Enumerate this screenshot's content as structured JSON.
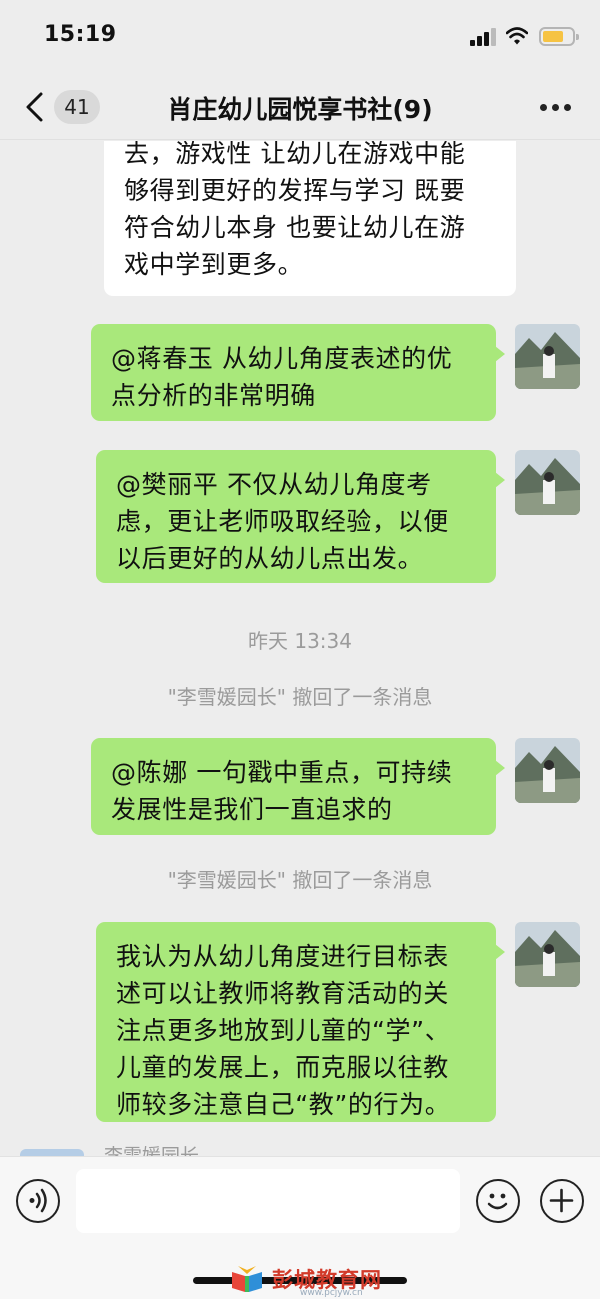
{
  "status": {
    "time": "15:19"
  },
  "nav": {
    "unread_count": "41",
    "title": "肖庄幼儿园悦享书社(9)"
  },
  "messages": [
    {
      "side": "left",
      "lines": [
        "去，游戏性 让幼儿在游戏中能",
        "够得到更好的发挥与学习  既要",
        "符合幼儿本身 也要让幼儿在游",
        "戏中学到更多。"
      ]
    },
    {
      "side": "right",
      "lines": [
        "@蒋春玉 从幼儿角度表述的优",
        "点分析的非常明确"
      ]
    },
    {
      "side": "right",
      "lines": [
        "@樊丽平 不仅从幼儿角度考",
        "虑，更让老师吸取经验，以便",
        "以后更好的从幼儿点出发。"
      ]
    },
    {
      "side": "right",
      "lines": [
        "@陈娜 一句戳中重点，可持续",
        "发展性是我们一直追求的"
      ]
    },
    {
      "side": "right",
      "lines": [
        "我认为从幼儿角度进行目标表",
        "述可以让教师将教育活动的关",
        "注点更多地放到儿童的“学”、",
        "儿童的发展上，而克服以往教",
        "师较多注意自己“教”的行为。"
      ]
    }
  ],
  "system": {
    "timestamp": "昨天 13:34",
    "recall_1": "\"李雪媛园长\" 撤回了一条消息",
    "recall_2": "\"李雪媛园长\" 撤回了一条消息"
  },
  "partial_sender": "李雪媛园长",
  "input": {
    "placeholder": ""
  },
  "watermark": {
    "text": "彭城教育网",
    "url": "www.pcjyw.cn"
  },
  "colors": {
    "background": "#ededed",
    "green_bubble": "#a9e87b",
    "white_bubble": "#ffffff",
    "system_text": "#9b9b9b",
    "battery": "#f6c343"
  },
  "icons": [
    "signal-icon",
    "wifi-icon",
    "battery-icon",
    "back-icon",
    "more-icon",
    "voice-icon",
    "emoji-icon",
    "plus-icon"
  ]
}
